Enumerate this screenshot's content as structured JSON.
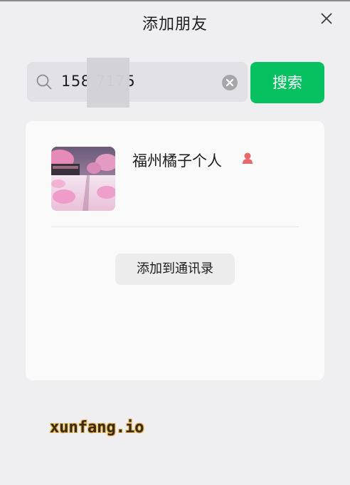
{
  "window": {
    "title": "添加朋友"
  },
  "search": {
    "value": "158     7175",
    "button_label": "搜索"
  },
  "result": {
    "name": "福州橘子个人",
    "gender_color": "#e8696b",
    "add_button_label": "添加到通讯录"
  },
  "watermark": {
    "text": "xunfang.io"
  },
  "colors": {
    "accent": "#07c160",
    "background": "#efeff2",
    "card": "#fafafa"
  },
  "icons": {
    "close": "close-icon",
    "search": "search-icon",
    "clear": "clear-icon",
    "gender": "female-icon"
  }
}
